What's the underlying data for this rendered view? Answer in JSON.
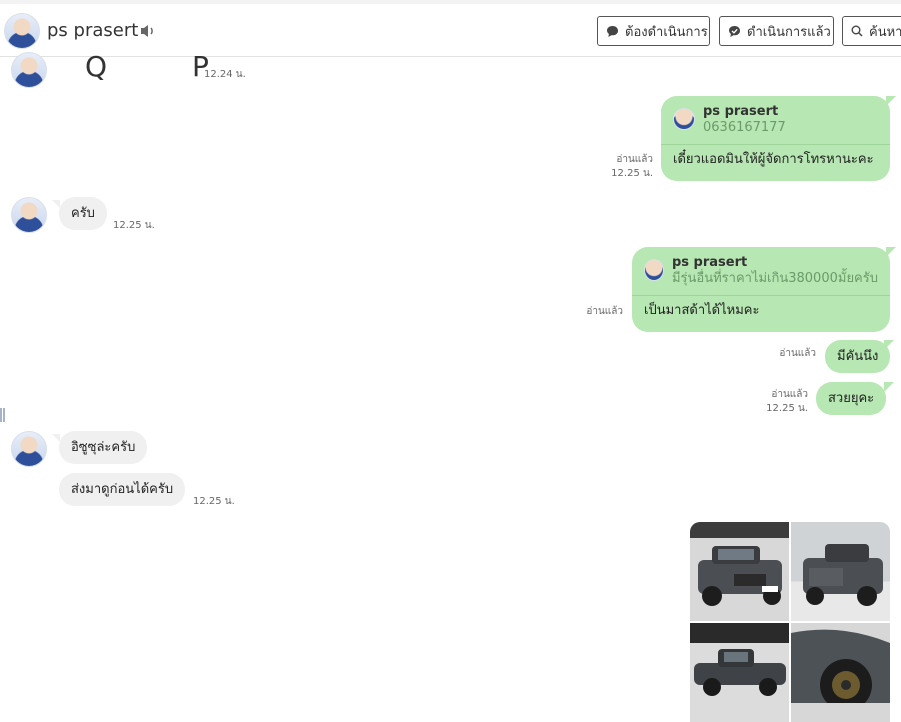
{
  "header": {
    "contact_name": "ps prasert",
    "pending_button": "ต้องดำเนินการ",
    "done_button": "ดำเนินการแล้ว",
    "search_button": "ค้นหา"
  },
  "messages": {
    "sticker_glyphs": "Q P",
    "sticker_time": "12.24 น.",
    "reply1_name": "ps prasert",
    "reply1_quote": "0636167177",
    "reply1_text": "เดี๋ยวแอดมินให้ผู้จัดการโทรหานะคะ",
    "reply1_read": "อ่านแล้ว",
    "reply1_time": "12.25 น.",
    "in1_text": "ครับ",
    "in1_time": "12.25 น.",
    "reply2_name": "ps prasert",
    "reply2_quote": "มีรุ่นอื่นที่ราคาไม่เกิน380000มั้ยครับ",
    "reply2_text": "เป็นมาสด้าได้ไหมคะ",
    "reply2_read": "อ่านแล้ว",
    "out3_text": "มีคันนึง",
    "out3_read": "อ่านแล้ว",
    "out4_text": "สวยยุคะ",
    "out4_read": "อ่านแล้ว",
    "out4_time": "12.25 น.",
    "in2_text": "อิซูซุล่ะครับ",
    "in3_text": "ส่งมาดูก่อนได้ครับ",
    "in3_time": "12.25 น."
  },
  "colors": {
    "outgoing_bubble": "#b7e7b2",
    "incoming_bubble": "#f0f0f0"
  }
}
